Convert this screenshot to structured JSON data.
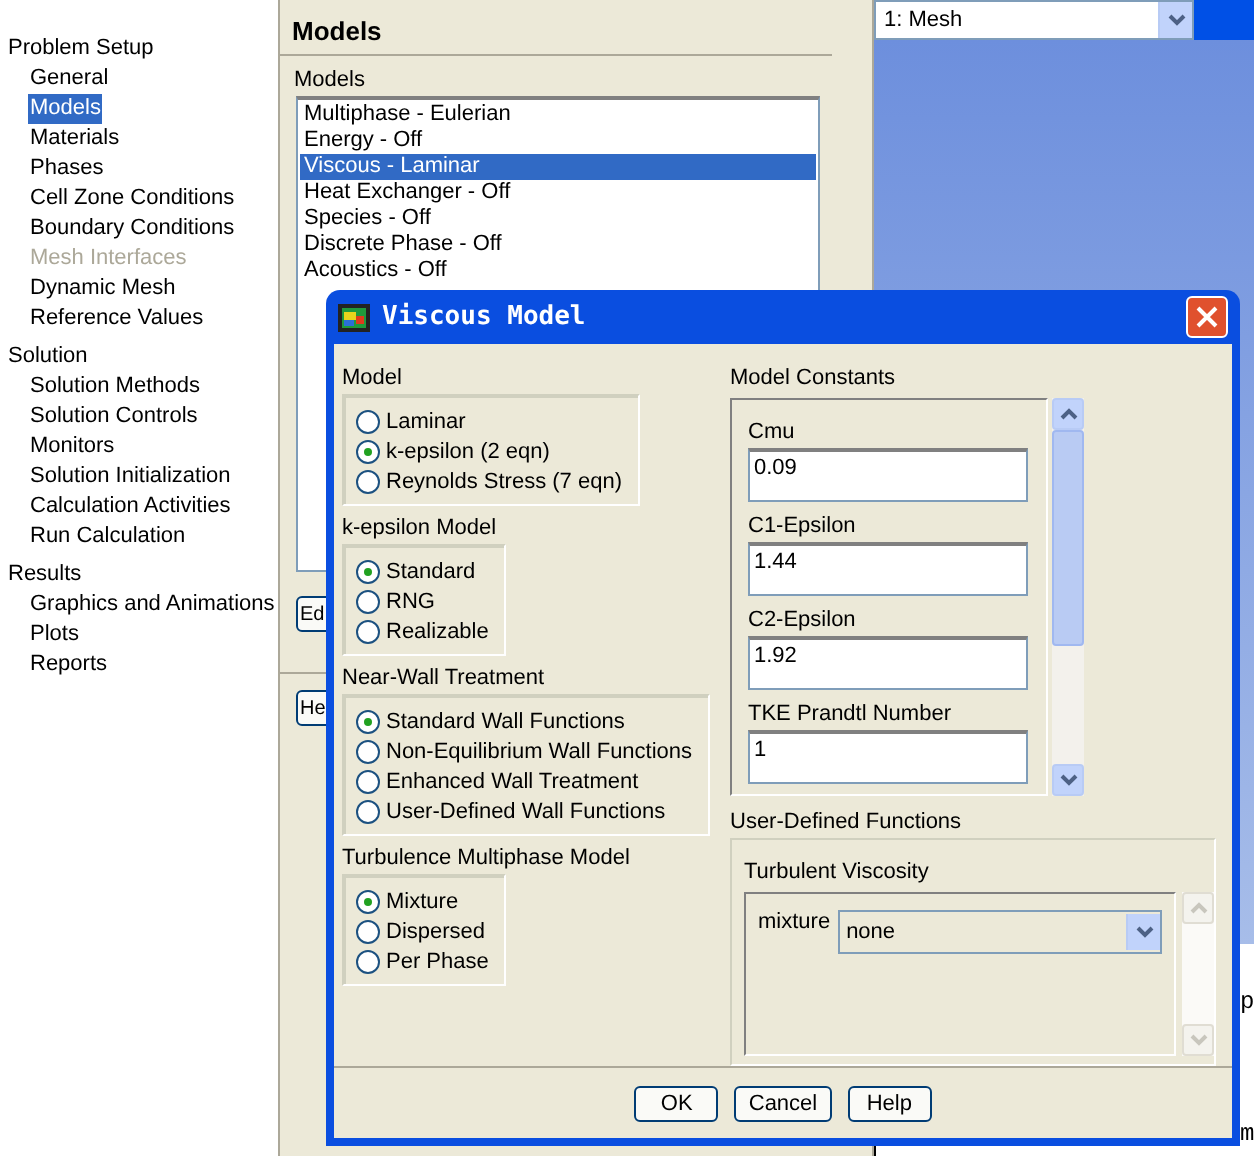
{
  "tree": [
    {
      "label": "Problem Setup",
      "children": [
        {
          "label": "General",
          "selected": false,
          "disabled": false
        },
        {
          "label": "Models",
          "selected": true,
          "disabled": false
        },
        {
          "label": "Materials",
          "selected": false,
          "disabled": false
        },
        {
          "label": "Phases",
          "selected": false,
          "disabled": false
        },
        {
          "label": "Cell Zone Conditions",
          "selected": false,
          "disabled": false
        },
        {
          "label": "Boundary Conditions",
          "selected": false,
          "disabled": false
        },
        {
          "label": "Mesh Interfaces",
          "selected": false,
          "disabled": true
        },
        {
          "label": "Dynamic Mesh",
          "selected": false,
          "disabled": false
        },
        {
          "label": "Reference Values",
          "selected": false,
          "disabled": false
        }
      ]
    },
    {
      "label": "Solution",
      "children": [
        {
          "label": "Solution Methods",
          "selected": false,
          "disabled": false
        },
        {
          "label": "Solution Controls",
          "selected": false,
          "disabled": false
        },
        {
          "label": "Monitors",
          "selected": false,
          "disabled": false
        },
        {
          "label": "Solution Initialization",
          "selected": false,
          "disabled": false
        },
        {
          "label": "Calculation Activities",
          "selected": false,
          "disabled": false
        },
        {
          "label": "Run Calculation",
          "selected": false,
          "disabled": false
        }
      ]
    },
    {
      "label": "Results",
      "children": [
        {
          "label": "Graphics and Animations",
          "selected": false,
          "disabled": false
        },
        {
          "label": "Plots",
          "selected": false,
          "disabled": false
        },
        {
          "label": "Reports",
          "selected": false,
          "disabled": false
        }
      ]
    }
  ],
  "task_page": {
    "title": "Models",
    "list_label": "Models",
    "models": [
      {
        "label": "Multiphase - Eulerian",
        "selected": false
      },
      {
        "label": "Energy - Off",
        "selected": false
      },
      {
        "label": "Viscous - Laminar",
        "selected": true
      },
      {
        "label": "Heat Exchanger - Off",
        "selected": false
      },
      {
        "label": "Species - Off",
        "selected": false
      },
      {
        "label": "Discrete Phase - Off",
        "selected": false
      },
      {
        "label": "Acoustics - Off",
        "selected": false
      }
    ],
    "buttons": [
      "Ed",
      "He"
    ]
  },
  "graphics": {
    "view_select": "1: Mesh",
    "console_fragments": [
      "p",
      "m"
    ]
  },
  "dialog": {
    "title": "Viscous Model",
    "groups": [
      {
        "label": "Model",
        "options": [
          {
            "label": "Laminar",
            "selected": false
          },
          {
            "label": "k-epsilon (2 eqn)",
            "selected": true
          },
          {
            "label": "Reynolds Stress (7 eqn)",
            "selected": false
          }
        ]
      },
      {
        "label": "k-epsilon Model",
        "options": [
          {
            "label": "Standard",
            "selected": true
          },
          {
            "label": "RNG",
            "selected": false
          },
          {
            "label": "Realizable",
            "selected": false
          }
        ]
      },
      {
        "label": "Near-Wall Treatment",
        "options": [
          {
            "label": "Standard Wall Functions",
            "selected": true
          },
          {
            "label": "Non-Equilibrium Wall Functions",
            "selected": false
          },
          {
            "label": "Enhanced Wall Treatment",
            "selected": false
          },
          {
            "label": "User-Defined Wall Functions",
            "selected": false
          }
        ]
      },
      {
        "label": "Turbulence Multiphase Model",
        "options": [
          {
            "label": "Mixture",
            "selected": true
          },
          {
            "label": "Dispersed",
            "selected": false
          },
          {
            "label": "Per Phase",
            "selected": false
          }
        ]
      }
    ],
    "constants": {
      "label": "Model Constants",
      "fields": [
        {
          "label": "Cmu",
          "value": "0.09"
        },
        {
          "label": "C1-Epsilon",
          "value": "1.44"
        },
        {
          "label": "C2-Epsilon",
          "value": "1.92"
        },
        {
          "label": "TKE Prandtl Number",
          "value": "1"
        }
      ]
    },
    "udf": {
      "label": "User-Defined Functions",
      "sub_label": "Turbulent Viscosity",
      "rows": [
        {
          "label": "mixture",
          "value": "none"
        }
      ]
    },
    "buttons": [
      "OK",
      "Cancel",
      "Help"
    ]
  }
}
